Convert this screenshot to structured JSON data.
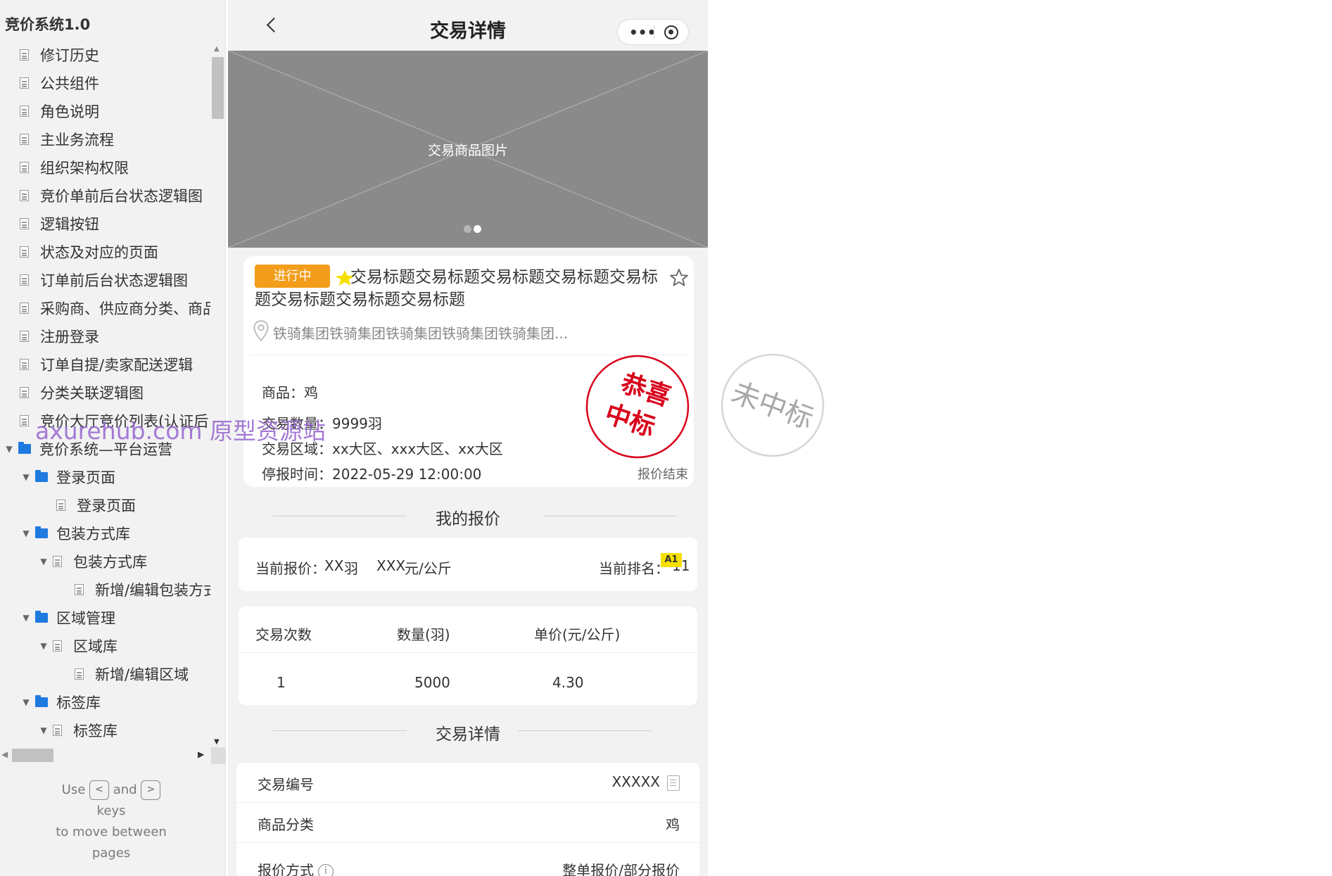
{
  "sidebar": {
    "title": "竞价系统1.0",
    "items": [
      {
        "label": "修订历史"
      },
      {
        "label": "公共组件"
      },
      {
        "label": "角色说明"
      },
      {
        "label": "主业务流程"
      },
      {
        "label": "组织架构权限"
      },
      {
        "label": "竞价单前后台状态逻辑图"
      },
      {
        "label": "逻辑按钮"
      },
      {
        "label": "状态及对应的页面"
      },
      {
        "label": "订单前后台状态逻辑图"
      },
      {
        "label": "采购商、供应商分类、商品"
      },
      {
        "label": "注册登录"
      },
      {
        "label": "订单自提/卖家配送逻辑"
      },
      {
        "label": "分类关联逻辑图"
      },
      {
        "label": "竞价大厅竞价列表(认证后"
      },
      {
        "label": "竞价系统—平台运营"
      },
      {
        "label": "登录页面"
      },
      {
        "label": "登录页面"
      },
      {
        "label": "包装方式库"
      },
      {
        "label": "包装方式库"
      },
      {
        "label": "新增/编辑包装方式"
      },
      {
        "label": "区域管理"
      },
      {
        "label": "区域库"
      },
      {
        "label": "新增/编辑区域"
      },
      {
        "label": "标签库"
      },
      {
        "label": "标签库"
      }
    ],
    "key_hint": {
      "use": "Use",
      "and": "and",
      "keys": "keys",
      "line3": "to move between",
      "line4": "pages",
      "key_left": "<",
      "key_right": ">"
    }
  },
  "watermark": "axurehub.com 原型资源站",
  "phone": {
    "nav_title": "交易详情",
    "capsule_more": "•••",
    "banner_text": "交易商品图片",
    "status_badge": "进行中",
    "trade_title": "交易标题交易标题交易标题交易标题交易标题交易标题交易标题交易标题",
    "company": "铁骑集团铁骑集团铁骑集团铁骑集团铁骑集团...",
    "goods": "商品：鸡",
    "quantity": "交易数量：9999羽",
    "region": "交易区域：xx大区、xxx大区、xx大区",
    "deadline": "停报时间：2022-05-29  12:00:00",
    "stamp_win_line1": "恭喜",
    "stamp_win_line2": "中标",
    "quote_end": "报价结束",
    "my_quote_title": "我的报价",
    "current_quote_label": "当前报价：",
    "current_quote_qty": "XX",
    "current_quote_qty_unit": "羽",
    "current_quote_price": "XXX",
    "current_quote_price_unit": "元/公斤",
    "current_rank_label": "当前排名：",
    "current_rank_value": "11",
    "rank_badge": "A1",
    "table": {
      "headers": [
        "交易次数",
        "数量(羽)",
        "单价(元/公斤)"
      ],
      "rows": [
        [
          "1",
          "5000",
          "4.30"
        ]
      ]
    },
    "detail_title": "交易详情",
    "details": [
      {
        "key": "交易编号",
        "value": "XXXXX"
      },
      {
        "key": "商品分类",
        "value": "鸡"
      },
      {
        "key": "报价方式",
        "value": "整单报价/部分报价"
      }
    ]
  },
  "lost_stamp": "未中标",
  "colors": {
    "accent_orange": "#f39d1a",
    "stamp_red": "#d9001b",
    "folder_blue": "#1f7ae0",
    "badge_yellow": "#f6e000"
  }
}
